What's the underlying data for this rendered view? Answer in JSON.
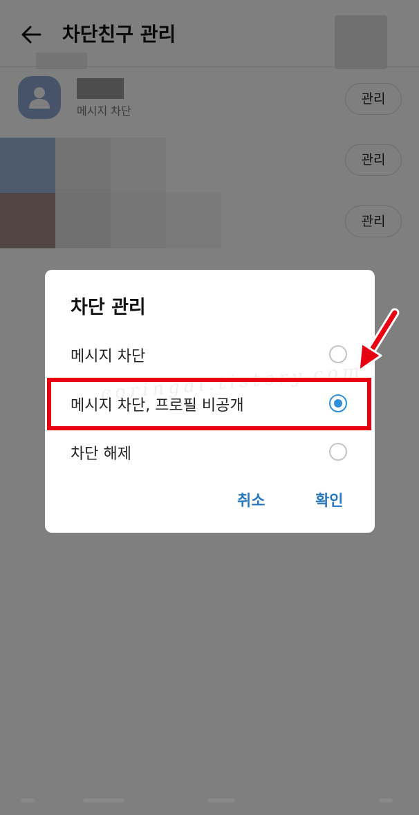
{
  "header": {
    "title": "차단친구 관리",
    "back_icon": "arrow-left-icon"
  },
  "blocked_list": {
    "items": [
      {
        "subtitle": "메시지 차단",
        "manage_label": "관리"
      },
      {
        "manage_label": "관리"
      },
      {
        "manage_label": "관리"
      }
    ]
  },
  "dialog": {
    "title": "차단 관리",
    "options": [
      {
        "label": "메시지 차단",
        "selected": false
      },
      {
        "label": "메시지 차단, 프로필 비공개",
        "selected": true
      },
      {
        "label": "차단 해제",
        "selected": false
      }
    ],
    "cancel_label": "취소",
    "confirm_label": "확인",
    "watermark": "coringai.tistory.com"
  },
  "colors": {
    "accent": "#2f8fd8",
    "button_text": "#2a78bd",
    "annotation": "#e60012",
    "overlay": "rgba(0,0,0,0.5)"
  }
}
